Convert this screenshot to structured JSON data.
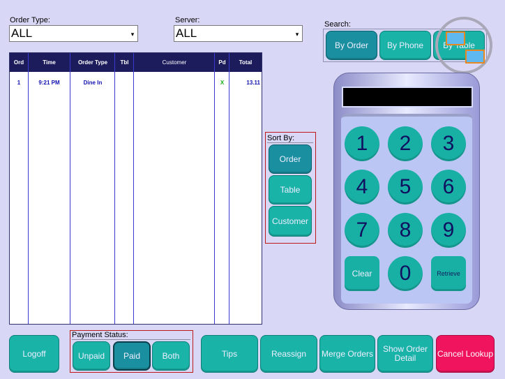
{
  "filters": {
    "order_type_label": "Order Type:",
    "order_type_value": "ALL",
    "server_label": "Server:",
    "server_value": "ALL"
  },
  "search": {
    "label": "Search:",
    "by_order": "By Order",
    "by_phone": "By Phone",
    "by_table": "By Table"
  },
  "table": {
    "headers": [
      "Ord",
      "Time",
      "Order Type",
      "Tbl",
      "Customer",
      "Pd",
      "Total"
    ],
    "rows": [
      {
        "ord": "1",
        "time": "9:21 PM",
        "order_type": "Dine In",
        "tbl": "",
        "customer": "",
        "pd": "X",
        "total": "13.11"
      }
    ]
  },
  "sort": {
    "label": "Sort By:",
    "order": "Order",
    "table": "Table",
    "customer": "Customer"
  },
  "keypad": {
    "keys": [
      "1",
      "2",
      "3",
      "4",
      "5",
      "6",
      "7",
      "8",
      "9"
    ],
    "clear": "Clear",
    "zero": "0",
    "retrieve": "Retrieve"
  },
  "payment": {
    "label": "Payment Status:",
    "unpaid": "Unpaid",
    "paid": "Paid",
    "both": "Both"
  },
  "bottom": {
    "logoff": "Logoff",
    "tips": "Tips",
    "reassign": "Reassign",
    "merge_orders": "Merge Orders",
    "show_order_detail": "Show Order Detail",
    "cancel_lookup": "Cancel Lookup"
  },
  "colors": {
    "background": "#d8d8f6",
    "button": "#19b3a8",
    "button_active": "#1a8fa0",
    "cancel": "#f0145e",
    "header": "#1c1c5c"
  }
}
